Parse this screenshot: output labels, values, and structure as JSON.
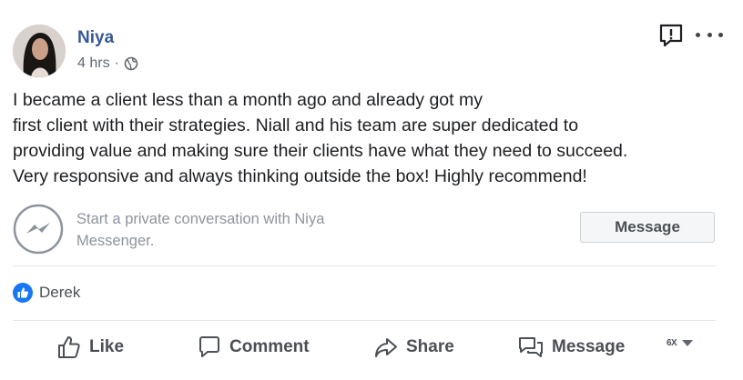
{
  "post": {
    "author": "Niya",
    "timestamp": "4 hrs",
    "separator": "·",
    "privacy_icon": "globe-icon",
    "body_lines": [
      "I became a client less than a month ago and already got my",
      "first client with their strategies. Niall and his team are super dedicated to",
      "providing value and making sure their clients have what they need to succeed.",
      "Very responsive and always thinking outside the box! Highly recommend!"
    ]
  },
  "messenger": {
    "icon": "messenger-icon",
    "prompt_line1": "Start a private conversation with Niya",
    "prompt_line2": "Messenger.",
    "button_label": "Message"
  },
  "reactions": {
    "icon": "like-badge-icon",
    "names": "Derek"
  },
  "actions": {
    "like": "Like",
    "comment": "Comment",
    "share": "Share",
    "message": "Message",
    "audience_label": "6X"
  },
  "colors": {
    "name_blue": "#385898",
    "text": "#1c1e21",
    "muted": "#606770",
    "like_blue": "#1877f2"
  }
}
